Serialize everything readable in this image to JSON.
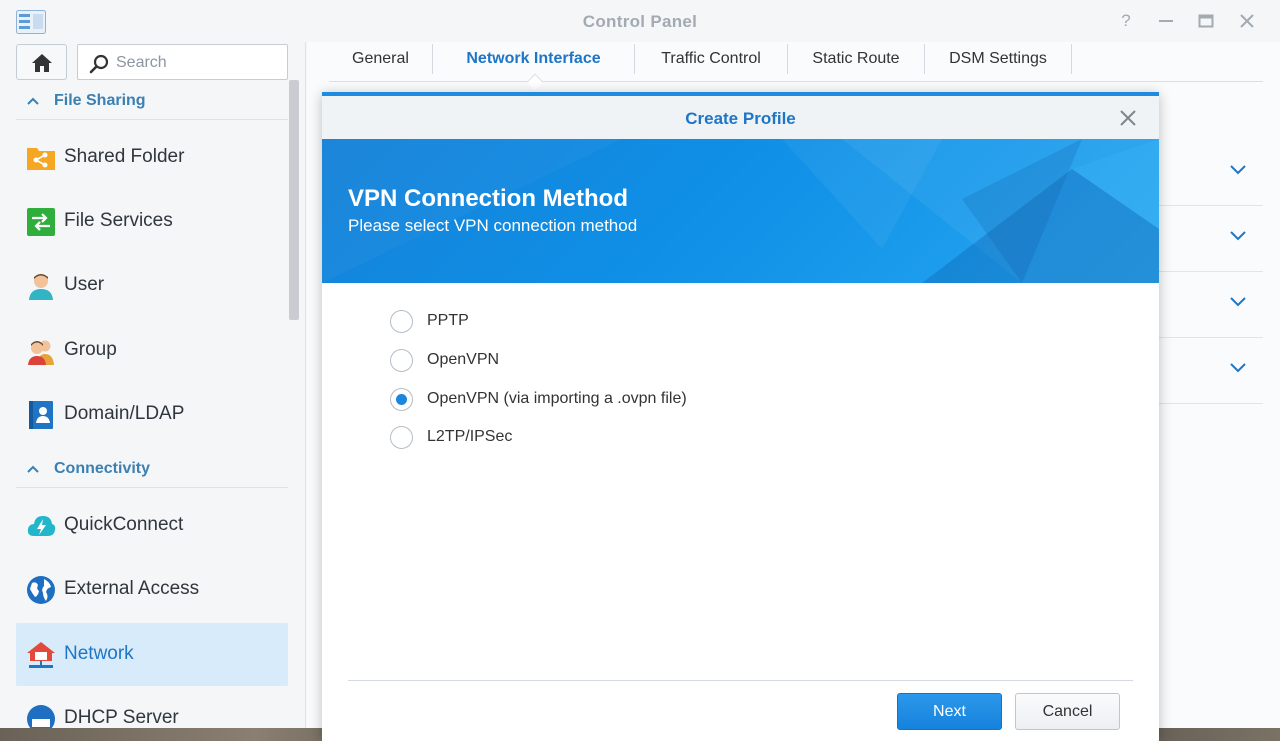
{
  "window": {
    "title": "Control Panel",
    "controls": [
      "help-icon",
      "minimize-icon",
      "maximize-icon",
      "close-icon"
    ]
  },
  "sidebar": {
    "search_placeholder": "Search",
    "sections": [
      {
        "label": "File Sharing",
        "items": [
          {
            "label": "Shared Folder",
            "icon": "shared-folder-icon"
          },
          {
            "label": "File Services",
            "icon": "file-services-icon"
          },
          {
            "label": "User",
            "icon": "user-icon"
          },
          {
            "label": "Group",
            "icon": "group-icon"
          },
          {
            "label": "Domain/LDAP",
            "icon": "domain-ldap-icon"
          }
        ]
      },
      {
        "label": "Connectivity",
        "items": [
          {
            "label": "QuickConnect",
            "icon": "quickconnect-icon"
          },
          {
            "label": "External Access",
            "icon": "external-access-icon"
          },
          {
            "label": "Network",
            "icon": "network-icon",
            "active": true
          },
          {
            "label": "DHCP Server",
            "icon": "dhcp-server-icon"
          }
        ]
      }
    ]
  },
  "tabs": [
    {
      "label": "General"
    },
    {
      "label": "Network Interface",
      "active": true
    },
    {
      "label": "Traffic Control"
    },
    {
      "label": "Static Route"
    },
    {
      "label": "DSM Settings"
    }
  ],
  "dialog": {
    "title": "Create Profile",
    "banner_title": "VPN Connection Method",
    "banner_subtitle": "Please select VPN connection method",
    "options": [
      {
        "label": "PPTP",
        "checked": false
      },
      {
        "label": "OpenVPN",
        "checked": false
      },
      {
        "label": "OpenVPN (via importing a .ovpn file)",
        "checked": true
      },
      {
        "label": "L2TP/IPSec",
        "checked": false
      }
    ],
    "next_label": "Next",
    "cancel_label": "Cancel"
  },
  "colors": {
    "accent": "#1e76c6",
    "primary_button": "#1b86de",
    "section_header": "#3c7fb1",
    "active_item_bg": "#d7ebfb"
  }
}
